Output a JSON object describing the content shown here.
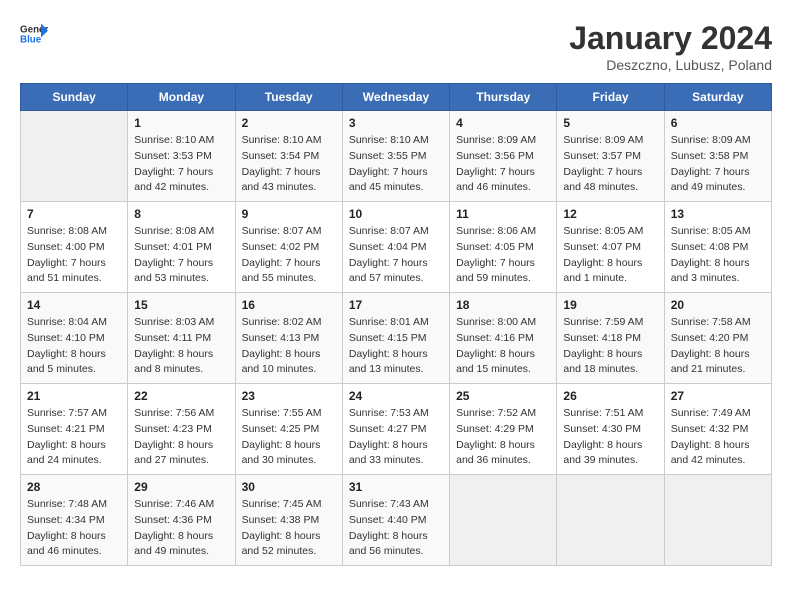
{
  "header": {
    "logo_line1": "General",
    "logo_line2": "Blue",
    "month_title": "January 2024",
    "subtitle": "Deszczno, Lubusz, Poland"
  },
  "days_of_week": [
    "Sunday",
    "Monday",
    "Tuesday",
    "Wednesday",
    "Thursday",
    "Friday",
    "Saturday"
  ],
  "weeks": [
    [
      {
        "day": "",
        "sunrise": "",
        "sunset": "",
        "daylight": ""
      },
      {
        "day": "1",
        "sunrise": "Sunrise: 8:10 AM",
        "sunset": "Sunset: 3:53 PM",
        "daylight": "Daylight: 7 hours and 42 minutes."
      },
      {
        "day": "2",
        "sunrise": "Sunrise: 8:10 AM",
        "sunset": "Sunset: 3:54 PM",
        "daylight": "Daylight: 7 hours and 43 minutes."
      },
      {
        "day": "3",
        "sunrise": "Sunrise: 8:10 AM",
        "sunset": "Sunset: 3:55 PM",
        "daylight": "Daylight: 7 hours and 45 minutes."
      },
      {
        "day": "4",
        "sunrise": "Sunrise: 8:09 AM",
        "sunset": "Sunset: 3:56 PM",
        "daylight": "Daylight: 7 hours and 46 minutes."
      },
      {
        "day": "5",
        "sunrise": "Sunrise: 8:09 AM",
        "sunset": "Sunset: 3:57 PM",
        "daylight": "Daylight: 7 hours and 48 minutes."
      },
      {
        "day": "6",
        "sunrise": "Sunrise: 8:09 AM",
        "sunset": "Sunset: 3:58 PM",
        "daylight": "Daylight: 7 hours and 49 minutes."
      }
    ],
    [
      {
        "day": "7",
        "sunrise": "Sunrise: 8:08 AM",
        "sunset": "Sunset: 4:00 PM",
        "daylight": "Daylight: 7 hours and 51 minutes."
      },
      {
        "day": "8",
        "sunrise": "Sunrise: 8:08 AM",
        "sunset": "Sunset: 4:01 PM",
        "daylight": "Daylight: 7 hours and 53 minutes."
      },
      {
        "day": "9",
        "sunrise": "Sunrise: 8:07 AM",
        "sunset": "Sunset: 4:02 PM",
        "daylight": "Daylight: 7 hours and 55 minutes."
      },
      {
        "day": "10",
        "sunrise": "Sunrise: 8:07 AM",
        "sunset": "Sunset: 4:04 PM",
        "daylight": "Daylight: 7 hours and 57 minutes."
      },
      {
        "day": "11",
        "sunrise": "Sunrise: 8:06 AM",
        "sunset": "Sunset: 4:05 PM",
        "daylight": "Daylight: 7 hours and 59 minutes."
      },
      {
        "day": "12",
        "sunrise": "Sunrise: 8:05 AM",
        "sunset": "Sunset: 4:07 PM",
        "daylight": "Daylight: 8 hours and 1 minute."
      },
      {
        "day": "13",
        "sunrise": "Sunrise: 8:05 AM",
        "sunset": "Sunset: 4:08 PM",
        "daylight": "Daylight: 8 hours and 3 minutes."
      }
    ],
    [
      {
        "day": "14",
        "sunrise": "Sunrise: 8:04 AM",
        "sunset": "Sunset: 4:10 PM",
        "daylight": "Daylight: 8 hours and 5 minutes."
      },
      {
        "day": "15",
        "sunrise": "Sunrise: 8:03 AM",
        "sunset": "Sunset: 4:11 PM",
        "daylight": "Daylight: 8 hours and 8 minutes."
      },
      {
        "day": "16",
        "sunrise": "Sunrise: 8:02 AM",
        "sunset": "Sunset: 4:13 PM",
        "daylight": "Daylight: 8 hours and 10 minutes."
      },
      {
        "day": "17",
        "sunrise": "Sunrise: 8:01 AM",
        "sunset": "Sunset: 4:15 PM",
        "daylight": "Daylight: 8 hours and 13 minutes."
      },
      {
        "day": "18",
        "sunrise": "Sunrise: 8:00 AM",
        "sunset": "Sunset: 4:16 PM",
        "daylight": "Daylight: 8 hours and 15 minutes."
      },
      {
        "day": "19",
        "sunrise": "Sunrise: 7:59 AM",
        "sunset": "Sunset: 4:18 PM",
        "daylight": "Daylight: 8 hours and 18 minutes."
      },
      {
        "day": "20",
        "sunrise": "Sunrise: 7:58 AM",
        "sunset": "Sunset: 4:20 PM",
        "daylight": "Daylight: 8 hours and 21 minutes."
      }
    ],
    [
      {
        "day": "21",
        "sunrise": "Sunrise: 7:57 AM",
        "sunset": "Sunset: 4:21 PM",
        "daylight": "Daylight: 8 hours and 24 minutes."
      },
      {
        "day": "22",
        "sunrise": "Sunrise: 7:56 AM",
        "sunset": "Sunset: 4:23 PM",
        "daylight": "Daylight: 8 hours and 27 minutes."
      },
      {
        "day": "23",
        "sunrise": "Sunrise: 7:55 AM",
        "sunset": "Sunset: 4:25 PM",
        "daylight": "Daylight: 8 hours and 30 minutes."
      },
      {
        "day": "24",
        "sunrise": "Sunrise: 7:53 AM",
        "sunset": "Sunset: 4:27 PM",
        "daylight": "Daylight: 8 hours and 33 minutes."
      },
      {
        "day": "25",
        "sunrise": "Sunrise: 7:52 AM",
        "sunset": "Sunset: 4:29 PM",
        "daylight": "Daylight: 8 hours and 36 minutes."
      },
      {
        "day": "26",
        "sunrise": "Sunrise: 7:51 AM",
        "sunset": "Sunset: 4:30 PM",
        "daylight": "Daylight: 8 hours and 39 minutes."
      },
      {
        "day": "27",
        "sunrise": "Sunrise: 7:49 AM",
        "sunset": "Sunset: 4:32 PM",
        "daylight": "Daylight: 8 hours and 42 minutes."
      }
    ],
    [
      {
        "day": "28",
        "sunrise": "Sunrise: 7:48 AM",
        "sunset": "Sunset: 4:34 PM",
        "daylight": "Daylight: 8 hours and 46 minutes."
      },
      {
        "day": "29",
        "sunrise": "Sunrise: 7:46 AM",
        "sunset": "Sunset: 4:36 PM",
        "daylight": "Daylight: 8 hours and 49 minutes."
      },
      {
        "day": "30",
        "sunrise": "Sunrise: 7:45 AM",
        "sunset": "Sunset: 4:38 PM",
        "daylight": "Daylight: 8 hours and 52 minutes."
      },
      {
        "day": "31",
        "sunrise": "Sunrise: 7:43 AM",
        "sunset": "Sunset: 4:40 PM",
        "daylight": "Daylight: 8 hours and 56 minutes."
      },
      {
        "day": "",
        "sunrise": "",
        "sunset": "",
        "daylight": ""
      },
      {
        "day": "",
        "sunrise": "",
        "sunset": "",
        "daylight": ""
      },
      {
        "day": "",
        "sunrise": "",
        "sunset": "",
        "daylight": ""
      }
    ]
  ]
}
